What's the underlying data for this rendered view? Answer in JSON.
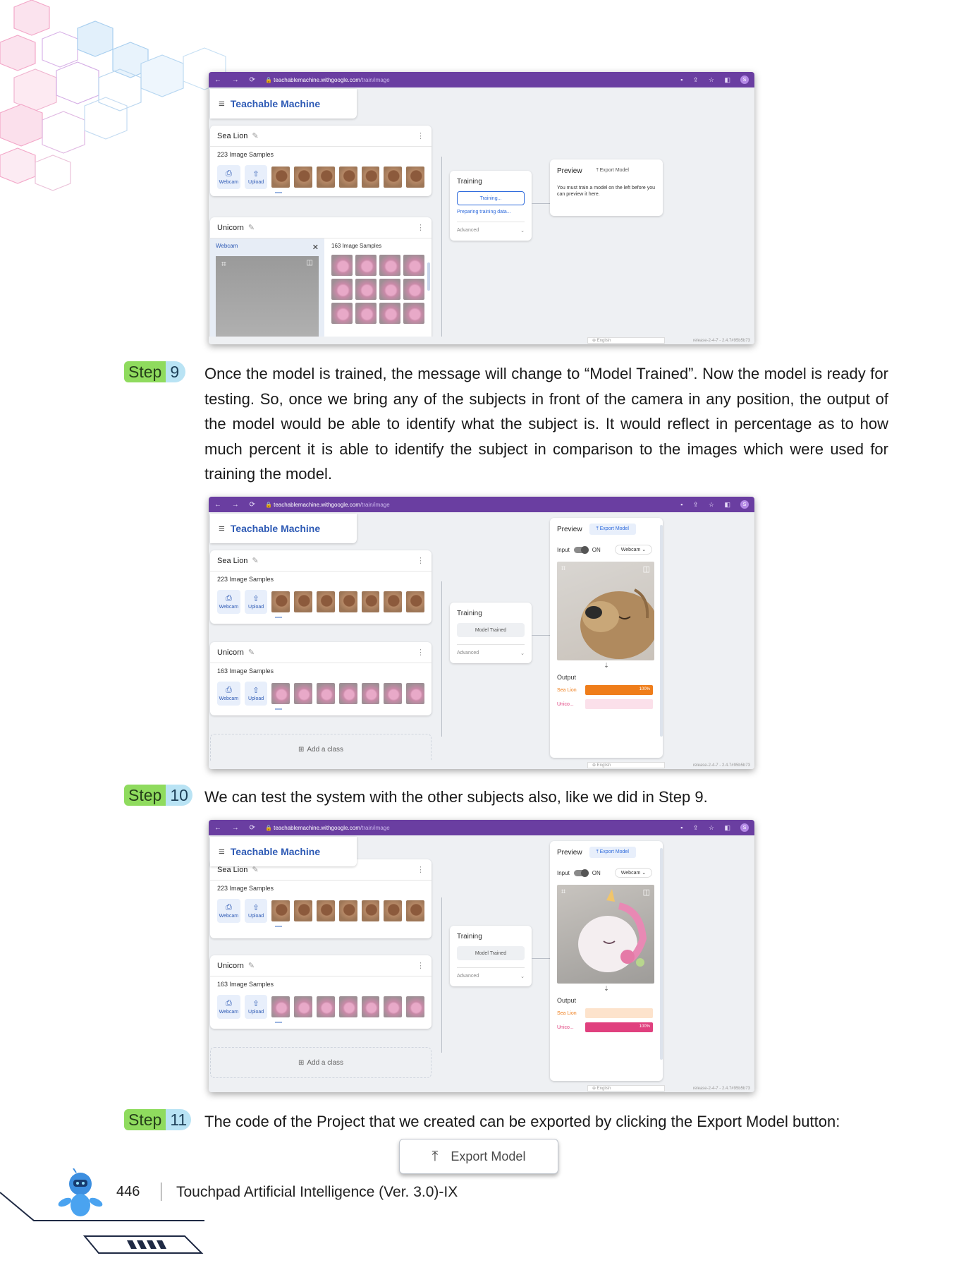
{
  "browser": {
    "url_host": "teachablemachine.withgoogle.com",
    "url_path": "/train/image",
    "profile_letter": "S"
  },
  "app": {
    "title": "Teachable Machine",
    "add_class": "Add a class",
    "language": "English",
    "release": "release-2-4-7 - 2.4.7#95b5b73"
  },
  "classes": [
    {
      "name": "Sea Lion",
      "samples": "223 Image Samples"
    },
    {
      "name": "Unicorn",
      "samples": "163 Image Samples"
    }
  ],
  "source_buttons": {
    "webcam": "Webcam",
    "upload": "Upload"
  },
  "training": {
    "label": "Training",
    "training_btn": "Training...",
    "preparing": "Preparing training data...",
    "trained_btn": "Model Trained",
    "advanced": "Advanced"
  },
  "preview": {
    "label": "Preview",
    "export": "Export Model",
    "message": "You must train a model on the left before you can preview it here.",
    "input": "Input",
    "on": "ON",
    "webcam": "Webcam",
    "output": "Output",
    "sea_lion_short": "Sea Lion",
    "unicorn_short": "Unico...",
    "pct": "100%"
  },
  "shot3": {
    "sea_lion_value": 1.0,
    "unicorn_value": 0.0
  },
  "shot4": {
    "sea_lion_value": 0.0,
    "unicorn_value": 1.0
  },
  "steps": [
    {
      "word": "Step",
      "num": "9",
      "text": "Once the model is trained, the message will change to “Model Trained”. Now the model is ready for testing. So, once we bring any of the subjects in front of the camera in any position, the output of the model would be able to identify what the subject is. It would reflect in percentage as to how much percent it is able to identify the subject in comparison to the images which were used for training the model."
    },
    {
      "word": "Step",
      "num": "10",
      "text": "We can test the system with the other subjects also, like we did in Step 9."
    },
    {
      "word": "Step",
      "num": "11",
      "text": "The code of the Project that we created can be exported by clicking the Export Model button:"
    }
  ],
  "export_button": "Export Model",
  "footer": {
    "page_number": "446",
    "book_title": "Touchpad Artificial Intelligence (Ver. 3.0)-IX"
  },
  "colors": {
    "chrome": "#6a3ea1",
    "accent_blue": "#2f5bb5",
    "sea_lion_orange": "#ef7d1a",
    "unicorn_pink": "#e0407e",
    "step_green": "#8fdb5e",
    "step_blue": "#b9e3f4"
  }
}
